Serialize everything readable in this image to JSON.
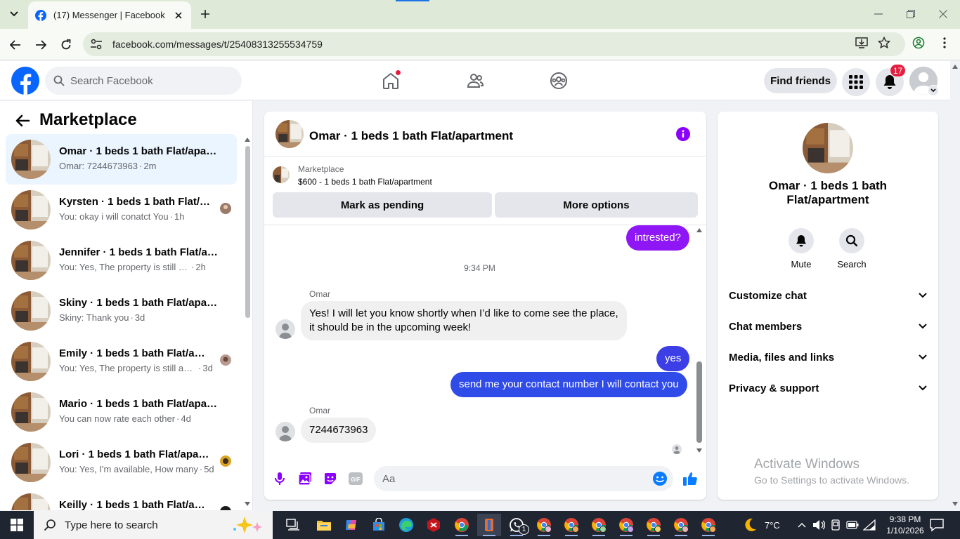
{
  "browser": {
    "tab_title": "(17) Messenger | Facebook",
    "url": "facebook.com/messages/t/25408313255534759"
  },
  "fb_header": {
    "search_placeholder": "Search Facebook",
    "find_friends": "Find friends",
    "notification_count": "17"
  },
  "left_panel": {
    "title": "Marketplace",
    "conversations": [
      {
        "name": "Omar · 1 beds 1 bath Flat/apartment",
        "preview": "Omar: 7244673963",
        "time": "2m",
        "active": true
      },
      {
        "name": "Kyrsten · 1 beds 1 bath Flat/apartment",
        "preview": "You: okay i will conatct You",
        "time": "1h"
      },
      {
        "name": "Jennifer · 1 beds 1 bath Flat/apartment",
        "preview": "You: Yes, The property is still available",
        "time": "2h"
      },
      {
        "name": "Skiny · 1 beds 1 bath Flat/apartment",
        "preview": "Skiny: Thank you",
        "time": "3d"
      },
      {
        "name": "Emily · 1 beds 1 bath Flat/apartment",
        "preview": "You: Yes, The property is still available",
        "time": "3d"
      },
      {
        "name": "Mario · 1 beds 1 bath Flat/apartment",
        "preview": "You can now rate each other",
        "time": "4d"
      },
      {
        "name": "Lori · 1 beds 1 bath Flat/apartment",
        "preview": "You: Yes, I'm available, How many",
        "time": "5d"
      },
      {
        "name": "Keilly · 1 beds 1 bath Flat/apartment",
        "preview": "",
        "time": ""
      }
    ]
  },
  "chat": {
    "title": "Omar · 1 beds 1 bath Flat/apartment",
    "marketplace_label": "Marketplace",
    "listing": "$600 - 1 beds 1 bath Flat/apartment",
    "mark_pending": "Mark as pending",
    "more_options": "More options",
    "timestamp": "9:34 PM",
    "messages": [
      {
        "from": "me",
        "text": "intrested?"
      },
      {
        "from": "Omar",
        "sender_label": "Omar",
        "lines": [
          "Yes! I will let you know shortly when I’d like to come see the place,",
          "it should be in the upcoming week!"
        ]
      },
      {
        "from": "me",
        "text": "yes"
      },
      {
        "from": "me",
        "text": "send me your contact number I will contact you"
      },
      {
        "from": "Omar",
        "sender_label": "Omar",
        "text": "7244673963"
      }
    ],
    "composer_placeholder": "Aa",
    "colors": {
      "accent": "#8b00ff",
      "bubble_top": "#8f16f5",
      "bubble_bottom": "#2f4be8",
      "like": "#0a7cff"
    }
  },
  "info_panel": {
    "name_line1": "Omar · 1 beds 1 bath",
    "name_line2": "Flat/apartment",
    "mute": "Mute",
    "search": "Search",
    "sections": [
      "Customize chat",
      "Chat members",
      "Media, files and links",
      "Privacy & support"
    ],
    "watermark_title": "Activate Windows",
    "watermark_sub": "Go to Settings to activate Windows."
  },
  "taskbar": {
    "search_placeholder": "Type here to search",
    "temperature": "7°C",
    "time": "9:38 PM",
    "date": "1/10/2026",
    "whatsapp_badge": "1"
  }
}
